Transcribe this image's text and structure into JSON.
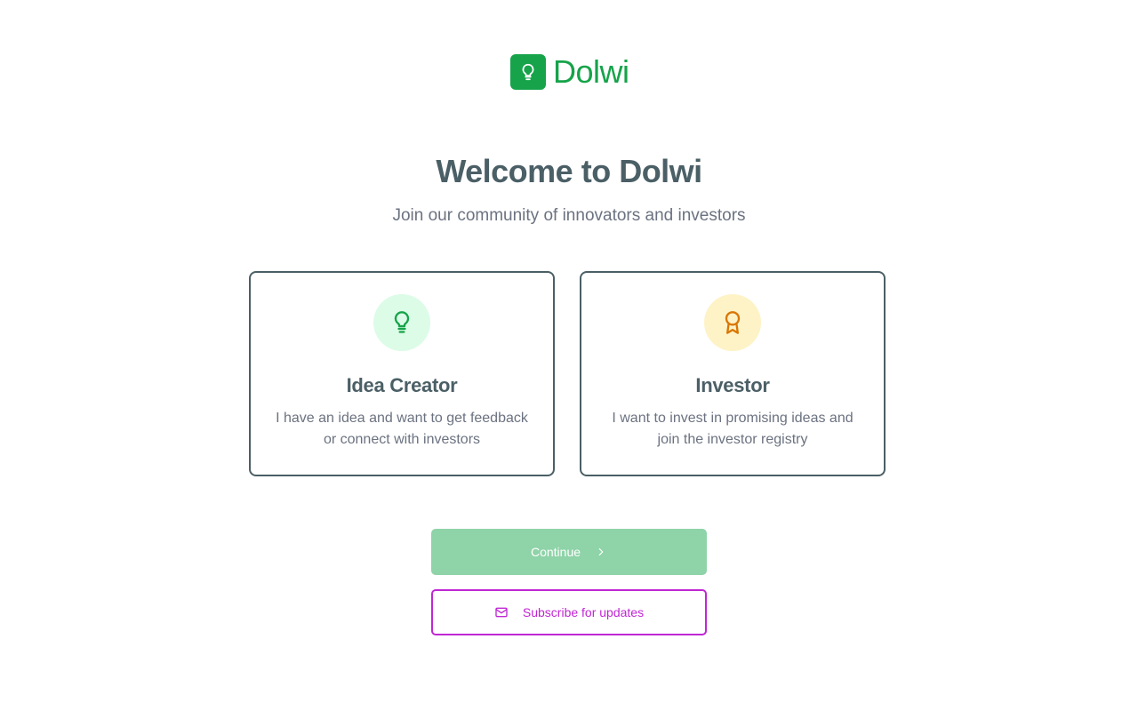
{
  "brand": {
    "name": "Dolwi",
    "logo_icon": "lightbulb-icon",
    "color": "#16a34a"
  },
  "header": {
    "title": "Welcome to Dolwi",
    "subtitle": "Join our community of innovators and investors"
  },
  "roles": [
    {
      "title": "Idea Creator",
      "description": "I have an idea and want to get feedback or connect with investors",
      "icon": "lightbulb-icon",
      "icon_color": "#16a34a",
      "icon_bg": "#dcfce7"
    },
    {
      "title": "Investor",
      "description": "I want to invest in promising ideas and join the investor registry",
      "icon": "award-icon",
      "icon_color": "#d97706",
      "icon_bg": "#fef3c7"
    }
  ],
  "actions": {
    "continue_label": "Continue",
    "continue_icon": "chevron-right-icon",
    "continue_color": "#8fd3a8",
    "subscribe_label": "Subscribe for updates",
    "subscribe_icon": "mail-icon",
    "subscribe_color": "#c026d3"
  },
  "colors": {
    "text_primary": "#4b5f66",
    "text_secondary": "#6b7280"
  }
}
